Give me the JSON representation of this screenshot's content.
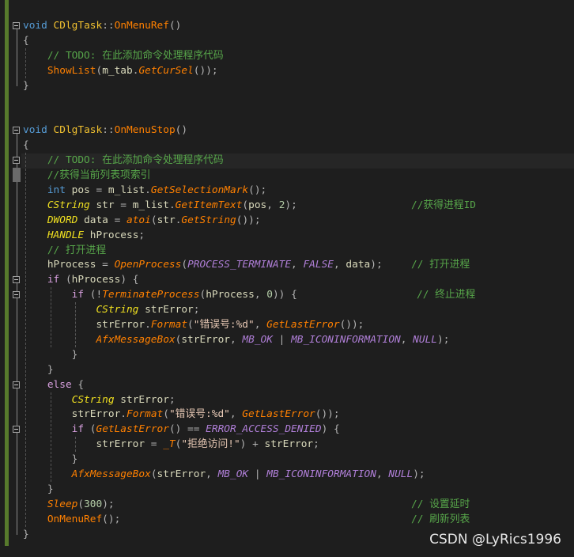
{
  "editor": {
    "lines": [
      [
        [
          "kw",
          "void"
        ],
        [
          "p",
          " "
        ],
        [
          "cls",
          "CDlgTask"
        ],
        [
          "p",
          "::"
        ],
        [
          "fn",
          "OnMenuRef"
        ],
        [
          "p",
          "()"
        ]
      ],
      [
        [
          "p",
          "{"
        ]
      ],
      [
        [
          "p",
          "    "
        ],
        [
          "cm",
          "// TODO: 在此添加命令处理程序代码"
        ]
      ],
      [
        [
          "p",
          "    "
        ],
        [
          "fn",
          "ShowList"
        ],
        [
          "p",
          "("
        ],
        [
          "var",
          "m_tab"
        ],
        [
          "p",
          "."
        ],
        [
          "fni",
          "GetCurSel"
        ],
        [
          "p",
          "());"
        ]
      ],
      [
        [
          "p",
          "}"
        ]
      ],
      [],
      [],
      [
        [
          "kw",
          "void"
        ],
        [
          "p",
          " "
        ],
        [
          "cls",
          "CDlgTask"
        ],
        [
          "p",
          "::"
        ],
        [
          "fn",
          "OnMenuStop"
        ],
        [
          "p",
          "()"
        ]
      ],
      [
        [
          "p",
          "{"
        ]
      ],
      [
        [
          "p",
          "    "
        ],
        [
          "cm",
          "// TODO: 在此添加命令处理程序代码"
        ]
      ],
      [
        [
          "p",
          "    "
        ],
        [
          "cm",
          "//获得当前列表项索引"
        ]
      ],
      [
        [
          "p",
          "    "
        ],
        [
          "kw",
          "int"
        ],
        [
          "var",
          " pos"
        ],
        [
          "p",
          " = "
        ],
        [
          "var",
          "m_list"
        ],
        [
          "p",
          "."
        ],
        [
          "fni",
          "GetSelectionMark"
        ],
        [
          "p",
          "();"
        ]
      ],
      [
        [
          "p",
          "    "
        ],
        [
          "type",
          "CString"
        ],
        [
          "var",
          " str"
        ],
        [
          "p",
          " = "
        ],
        [
          "var",
          "m_list"
        ],
        [
          "p",
          "."
        ],
        [
          "fni",
          "GetItemText"
        ],
        [
          "p",
          "("
        ],
        [
          "var",
          "pos"
        ],
        [
          "p",
          ", "
        ],
        [
          "num",
          "2"
        ],
        [
          "p",
          ");"
        ]
      ],
      [
        [
          "p",
          "    "
        ],
        [
          "type",
          "DWORD"
        ],
        [
          "var",
          " data"
        ],
        [
          "p",
          " = "
        ],
        [
          "fni",
          "atoi"
        ],
        [
          "p",
          "("
        ],
        [
          "var",
          "str"
        ],
        [
          "p",
          "."
        ],
        [
          "fni",
          "GetString"
        ],
        [
          "p",
          "());"
        ]
      ],
      [
        [
          "p",
          "    "
        ],
        [
          "type",
          "HANDLE"
        ],
        [
          "var",
          " hProcess"
        ],
        [
          "p",
          ";"
        ]
      ],
      [
        [
          "p",
          "    "
        ],
        [
          "cm",
          "// 打开进程"
        ]
      ],
      [
        [
          "p",
          "    "
        ],
        [
          "var",
          "hProcess"
        ],
        [
          "p",
          " = "
        ],
        [
          "fni",
          "OpenProcess"
        ],
        [
          "p",
          "("
        ],
        [
          "mac",
          "PROCESS_TERMINATE"
        ],
        [
          "p",
          ", "
        ],
        [
          "mac",
          "FALSE"
        ],
        [
          "p",
          ", "
        ],
        [
          "var",
          "data"
        ],
        [
          "p",
          ");"
        ]
      ],
      [
        [
          "p",
          "    "
        ],
        [
          "ctl",
          "if"
        ],
        [
          "p",
          " ("
        ],
        [
          "var",
          "hProcess"
        ],
        [
          "p",
          ") {"
        ]
      ],
      [
        [
          "p",
          "        "
        ],
        [
          "ctl",
          "if"
        ],
        [
          "p",
          " (!"
        ],
        [
          "fni",
          "TerminateProcess"
        ],
        [
          "p",
          "("
        ],
        [
          "var",
          "hProcess"
        ],
        [
          "p",
          ", "
        ],
        [
          "num",
          "0"
        ],
        [
          "p",
          ")) {"
        ]
      ],
      [
        [
          "p",
          "            "
        ],
        [
          "type",
          "CString"
        ],
        [
          "var",
          " strError"
        ],
        [
          "p",
          ";"
        ]
      ],
      [
        [
          "p",
          "            "
        ],
        [
          "var",
          "strError"
        ],
        [
          "p",
          "."
        ],
        [
          "fni",
          "Format"
        ],
        [
          "p",
          "("
        ],
        [
          "str",
          "\"错误号:%d\""
        ],
        [
          "p",
          ", "
        ],
        [
          "fni",
          "GetLastError"
        ],
        [
          "p",
          "());"
        ]
      ],
      [
        [
          "p",
          "            "
        ],
        [
          "fni",
          "AfxMessageBox"
        ],
        [
          "p",
          "("
        ],
        [
          "var",
          "strError"
        ],
        [
          "p",
          ", "
        ],
        [
          "mac",
          "MB_OK"
        ],
        [
          "p",
          " | "
        ],
        [
          "mac",
          "MB_ICONINFORMATION"
        ],
        [
          "p",
          ", "
        ],
        [
          "mac",
          "NULL"
        ],
        [
          "p",
          ");"
        ]
      ],
      [
        [
          "p",
          "        }"
        ]
      ],
      [
        [
          "p",
          "    }"
        ]
      ],
      [
        [
          "p",
          "    "
        ],
        [
          "ctl",
          "else"
        ],
        [
          "p",
          " {"
        ]
      ],
      [
        [
          "p",
          "        "
        ],
        [
          "type",
          "CString"
        ],
        [
          "var",
          " strError"
        ],
        [
          "p",
          ";"
        ]
      ],
      [
        [
          "p",
          "        "
        ],
        [
          "var",
          "strError"
        ],
        [
          "p",
          "."
        ],
        [
          "fni",
          "Format"
        ],
        [
          "p",
          "("
        ],
        [
          "str",
          "\"错误号:%d\""
        ],
        [
          "p",
          ", "
        ],
        [
          "fni",
          "GetLastError"
        ],
        [
          "p",
          "());"
        ]
      ],
      [
        [
          "p",
          "        "
        ],
        [
          "ctl",
          "if"
        ],
        [
          "p",
          " ("
        ],
        [
          "fni",
          "GetLastError"
        ],
        [
          "p",
          "() == "
        ],
        [
          "mac",
          "ERROR_ACCESS_DENIED"
        ],
        [
          "p",
          ") {"
        ]
      ],
      [
        [
          "p",
          "            "
        ],
        [
          "var",
          "strError"
        ],
        [
          "p",
          " = "
        ],
        [
          "fni",
          "_T"
        ],
        [
          "p",
          "("
        ],
        [
          "str",
          "\"拒绝访问!\""
        ],
        [
          "p",
          ") + "
        ],
        [
          "var",
          "strError"
        ],
        [
          "p",
          ";"
        ]
      ],
      [
        [
          "p",
          "        }"
        ]
      ],
      [
        [
          "p",
          "        "
        ],
        [
          "fni",
          "AfxMessageBox"
        ],
        [
          "p",
          "("
        ],
        [
          "var",
          "strError"
        ],
        [
          "p",
          ", "
        ],
        [
          "mac",
          "MB_OK"
        ],
        [
          "p",
          " | "
        ],
        [
          "mac",
          "MB_ICONINFORMATION"
        ],
        [
          "p",
          ", "
        ],
        [
          "mac",
          "NULL"
        ],
        [
          "p",
          ");"
        ]
      ],
      [
        [
          "p",
          "    }"
        ]
      ],
      [
        [
          "p",
          "    "
        ],
        [
          "fni",
          "Sleep"
        ],
        [
          "p",
          "("
        ],
        [
          "num",
          "300"
        ],
        [
          "p",
          ");"
        ]
      ],
      [
        [
          "p",
          "    "
        ],
        [
          "fn",
          "OnMenuRef"
        ],
        [
          "p",
          "();"
        ]
      ],
      [
        [
          "p",
          "}"
        ]
      ]
    ],
    "trailing_comments": [
      {
        "line": 12,
        "text": "//获得进程ID"
      },
      {
        "line": 16,
        "text": "// 打开进程"
      },
      {
        "line": 18,
        "text": "// 终止进程"
      },
      {
        "line": 32,
        "text": "// 设置延时"
      },
      {
        "line": 33,
        "text": "// 刷新列表"
      }
    ],
    "fold_lines": [
      0,
      7,
      9,
      17,
      18,
      24,
      27
    ]
  },
  "watermark": "CSDN @LyRics1996"
}
